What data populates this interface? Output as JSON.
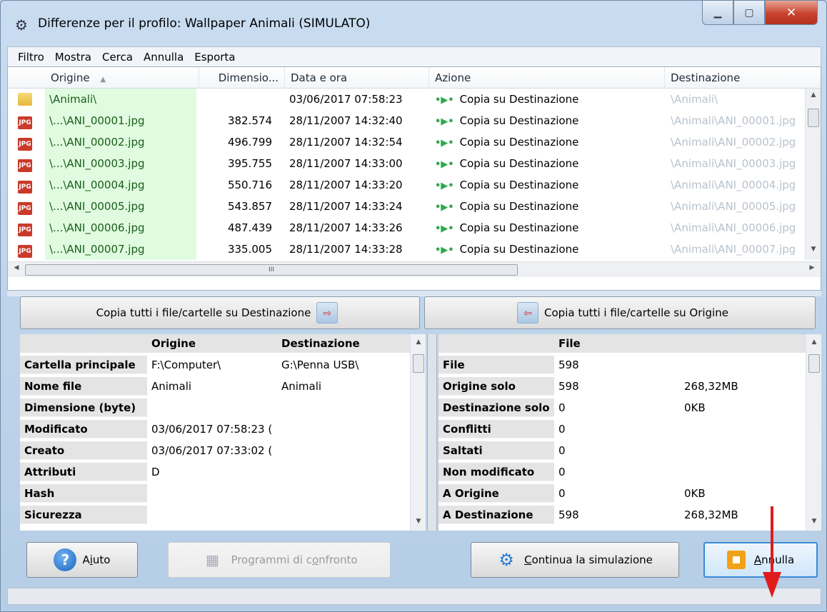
{
  "window": {
    "title": "Differenze per il profilo: Wallpaper Animali (SIMULATO)",
    "icon": "profile-icon"
  },
  "menu": [
    "Filtro",
    "Mostra",
    "Cerca",
    "Annulla",
    "Esporta"
  ],
  "list": {
    "columns": [
      "Origine",
      "Dimensio...",
      "Data e ora",
      "Azione",
      "Destinazione"
    ],
    "sort_indicator": "▲",
    "rows": [
      {
        "type": "folder",
        "origin": "\\Animali\\",
        "size": "",
        "date": "03/06/2017 07:58:23",
        "action": "Copia su Destinazione",
        "dest": "\\Animali\\"
      },
      {
        "type": "jpg",
        "origin": "\\...\\ANI_00001.jpg",
        "size": "382.574",
        "date": "28/11/2007 14:32:40",
        "action": "Copia su Destinazione",
        "dest": "\\Animali\\ANI_00001.jpg"
      },
      {
        "type": "jpg",
        "origin": "\\...\\ANI_00002.jpg",
        "size": "496.799",
        "date": "28/11/2007 14:32:54",
        "action": "Copia su Destinazione",
        "dest": "\\Animali\\ANI_00002.jpg"
      },
      {
        "type": "jpg",
        "origin": "\\...\\ANI_00003.jpg",
        "size": "395.755",
        "date": "28/11/2007 14:33:00",
        "action": "Copia su Destinazione",
        "dest": "\\Animali\\ANI_00003.jpg"
      },
      {
        "type": "jpg",
        "origin": "\\...\\ANI_00004.jpg",
        "size": "550.716",
        "date": "28/11/2007 14:33:20",
        "action": "Copia su Destinazione",
        "dest": "\\Animali\\ANI_00004.jpg"
      },
      {
        "type": "jpg",
        "origin": "\\...\\ANI_00005.jpg",
        "size": "543.857",
        "date": "28/11/2007 14:33:24",
        "action": "Copia su Destinazione",
        "dest": "\\Animali\\ANI_00005.jpg"
      },
      {
        "type": "jpg",
        "origin": "\\...\\ANI_00006.jpg",
        "size": "487.439",
        "date": "28/11/2007 14:33:26",
        "action": "Copia su Destinazione",
        "dest": "\\Animali\\ANI_00006.jpg"
      },
      {
        "type": "jpg",
        "origin": "\\...\\ANI_00007.jpg",
        "size": "335.005",
        "date": "28/11/2007 14:33:28",
        "action": "Copia su Destinazione",
        "dest": "\\Animali\\ANI_00007.jpg"
      }
    ],
    "hscroll_grip": "III"
  },
  "copy_buttons": {
    "to_dest": "Copia tutti i file/cartelle su Destinazione",
    "to_origin": "Copia tutti i file/cartelle su Origine"
  },
  "details": {
    "headers": [
      "Origine",
      "Destinazione"
    ],
    "rows": [
      {
        "label": "Cartella principale",
        "origin": "F:\\Computer\\",
        "dest": "G:\\Penna USB\\"
      },
      {
        "label": "Nome file",
        "origin": "Animali",
        "dest": "Animali"
      },
      {
        "label": "Dimensione (byte)",
        "origin": "",
        "dest": ""
      },
      {
        "label": "Modificato",
        "origin": "03/06/2017 07:58:23 (",
        "dest": ""
      },
      {
        "label": "Creato",
        "origin": "03/06/2017 07:33:02 (",
        "dest": ""
      },
      {
        "label": "Attributi",
        "origin": "D",
        "dest": ""
      },
      {
        "label": "Hash",
        "origin": "",
        "dest": ""
      },
      {
        "label": "Sicurezza",
        "origin": "",
        "dest": ""
      }
    ]
  },
  "stats": {
    "header": "File",
    "rows": [
      {
        "label": "File",
        "count": "598",
        "size": ""
      },
      {
        "label": "Origine solo",
        "count": "598",
        "size": "268,32MB"
      },
      {
        "label": "Destinazione solo",
        "count": "0",
        "size": "0KB"
      },
      {
        "label": "Conflitti",
        "count": "0",
        "size": ""
      },
      {
        "label": "Saltati",
        "count": "0",
        "size": ""
      },
      {
        "label": "Non modificato",
        "count": "0",
        "size": ""
      },
      {
        "label": "A Origine",
        "count": "0",
        "size": "0KB"
      },
      {
        "label": "A Destinazione",
        "count": "598",
        "size": "268,32MB"
      }
    ]
  },
  "buttons": {
    "help_pre": "A",
    "help_u": "i",
    "help_post": "uto",
    "compare_pre": "Programmi di c",
    "compare_u": "o",
    "compare_post": "nfronto",
    "continue_u": "C",
    "continue_post": "ontinua la simulazione",
    "cancel_u": "A",
    "cancel_post": "nnulla"
  },
  "colors": {
    "origin_highlight": "#e0fbe0",
    "action_arrow": "#2fa84f",
    "annotation_arrow": "#e01b1b"
  }
}
